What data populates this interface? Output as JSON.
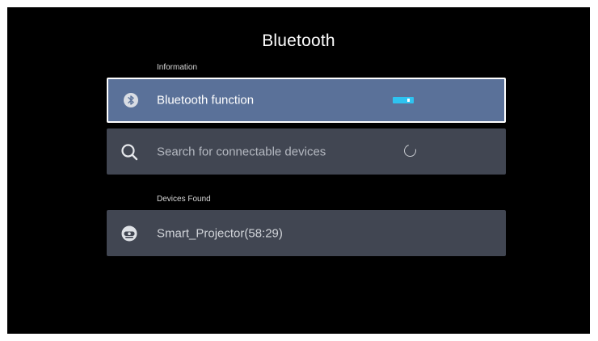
{
  "header": {
    "title": "Bluetooth"
  },
  "sections": {
    "information_label": "Information",
    "devices_found_label": "Devices Found"
  },
  "bluetooth_row": {
    "label": "Bluetooth function",
    "icon": "bluetooth-icon",
    "toggle_state": "on",
    "selected": true
  },
  "search_row": {
    "label": "Search for connectable devices",
    "icon": "search-icon",
    "status_icon": "loading-spinner-icon"
  },
  "devices": [
    {
      "label": "Smart_Projector(58:29)",
      "icon": "projector-device-icon"
    }
  ],
  "colors": {
    "background": "#000000",
    "row_background": "#414652",
    "selected_row": "#5a7199",
    "toggle_on": "#2ec3f0"
  }
}
